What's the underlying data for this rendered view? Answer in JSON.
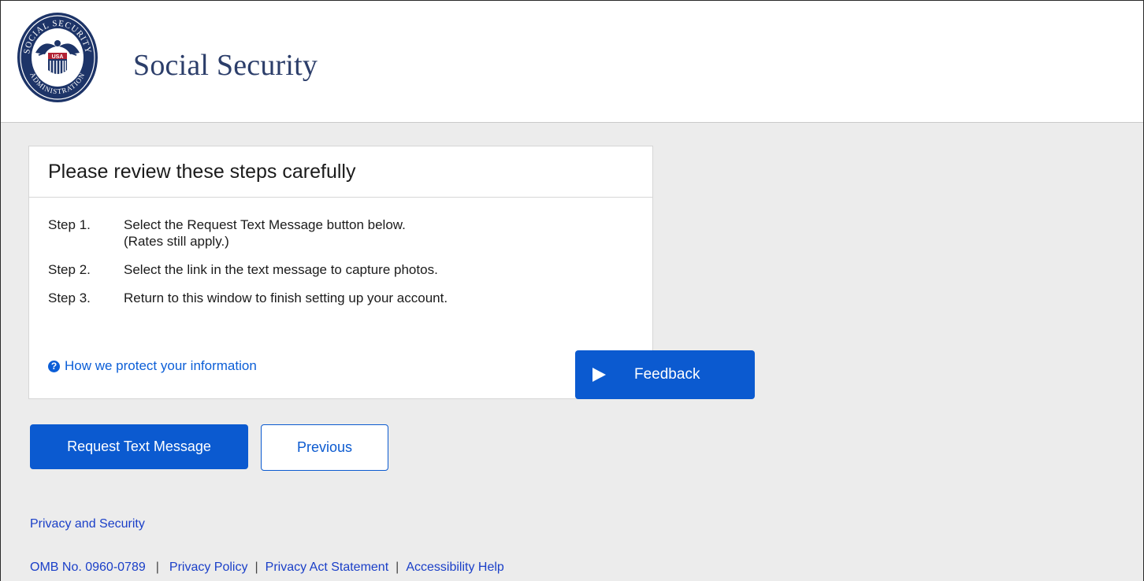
{
  "header": {
    "site_title": "Social Security",
    "logo": {
      "name": "ssa-seal-logo",
      "ring_text_top": "SOCIAL SECURITY",
      "ring_text_bottom": "ADMINISTRATION",
      "center_text": "USA"
    }
  },
  "card": {
    "title": "Please review these steps carefully",
    "steps": [
      {
        "label": "Step 1.",
        "text": "Select the Request Text Message button below.",
        "text2": "(Rates still apply.)"
      },
      {
        "label": "Step 2.",
        "text": "Select the link in the text message to capture photos."
      },
      {
        "label": "Step 3.",
        "text": "Return to this window to finish setting up your account."
      }
    ],
    "help_link": "How we protect your information",
    "help_icon": "question-circle-icon"
  },
  "feedback": {
    "label": "Feedback",
    "icon": "play-icon"
  },
  "buttons": {
    "request": "Request Text Message",
    "previous": "Previous"
  },
  "links": {
    "privacy_security": "Privacy and Security"
  },
  "footer": {
    "omb": "OMB No. 0960-0789",
    "privacy_policy": "Privacy Policy",
    "privacy_act": "Privacy Act Statement",
    "accessibility": "Accessibility Help",
    "separator": "|"
  },
  "colors": {
    "brand_blue": "#0b5ad0",
    "link_blue": "#1a3fc8",
    "title_navy": "#2c3e6a",
    "background": "#ececec"
  }
}
